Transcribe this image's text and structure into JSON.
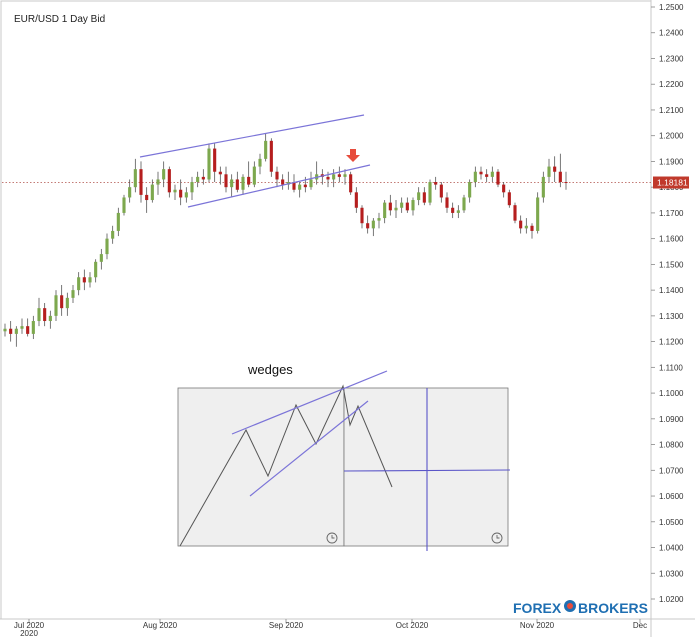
{
  "chart_data": {
    "type": "candlestick",
    "title": "EUR/USD  1 Day Bid",
    "ylim": [
      1.01,
      1.25
    ],
    "y_ticks": [
      "1.2500",
      "1.2400",
      "1.2300",
      "1.2200",
      "1.2100",
      "1.2000",
      "1.1900",
      "1.1800",
      "1.1700",
      "1.1600",
      "1.1500",
      "1.1400",
      "1.1300",
      "1.1200",
      "1.1100",
      "1.1000",
      "1.0900",
      "1.0800",
      "1.0700",
      "1.0600",
      "1.0500",
      "1.0400",
      "1.0300",
      "1.0200"
    ],
    "x_ticks": [
      "Jul 2020",
      "Aug 2020",
      "Sep 2020",
      "Oct 2020",
      "Nov 2020",
      "Dec"
    ],
    "x_ticks_year": [
      "2020"
    ],
    "current_price": "1.18181",
    "annotation": "wedges",
    "colors": {
      "up": "#7da84e",
      "down": "#b51e1e",
      "trendline": "#7b74d8",
      "price_tag": "#c0392b",
      "arrow": "#e74c3c",
      "axis_text": "#333333"
    },
    "candles": [
      [
        1.124,
        1.127,
        1.122,
        1.125
      ],
      [
        1.125,
        1.128,
        1.12,
        1.123
      ],
      [
        1.123,
        1.126,
        1.118,
        1.125
      ],
      [
        1.125,
        1.129,
        1.123,
        1.126
      ],
      [
        1.126,
        1.129,
        1.122,
        1.123
      ],
      [
        1.123,
        1.13,
        1.121,
        1.128
      ],
      [
        1.128,
        1.137,
        1.126,
        1.133
      ],
      [
        1.133,
        1.135,
        1.126,
        1.128
      ],
      [
        1.128,
        1.132,
        1.125,
        1.13
      ],
      [
        1.13,
        1.14,
        1.128,
        1.138
      ],
      [
        1.138,
        1.142,
        1.13,
        1.133
      ],
      [
        1.133,
        1.139,
        1.13,
        1.137
      ],
      [
        1.137,
        1.142,
        1.135,
        1.14
      ],
      [
        1.14,
        1.147,
        1.138,
        1.145
      ],
      [
        1.145,
        1.148,
        1.14,
        1.143
      ],
      [
        1.143,
        1.147,
        1.141,
        1.145
      ],
      [
        1.145,
        1.152,
        1.143,
        1.151
      ],
      [
        1.151,
        1.156,
        1.148,
        1.154
      ],
      [
        1.154,
        1.162,
        1.152,
        1.16
      ],
      [
        1.16,
        1.165,
        1.158,
        1.163
      ],
      [
        1.163,
        1.172,
        1.161,
        1.17
      ],
      [
        1.17,
        1.177,
        1.169,
        1.176
      ],
      [
        1.176,
        1.183,
        1.174,
        1.18
      ],
      [
        1.18,
        1.191,
        1.178,
        1.187
      ],
      [
        1.187,
        1.19,
        1.174,
        1.177
      ],
      [
        1.177,
        1.18,
        1.17,
        1.175
      ],
      [
        1.175,
        1.183,
        1.174,
        1.181
      ],
      [
        1.181,
        1.186,
        1.177,
        1.183
      ],
      [
        1.183,
        1.19,
        1.18,
        1.187
      ],
      [
        1.187,
        1.188,
        1.176,
        1.178
      ],
      [
        1.178,
        1.181,
        1.175,
        1.179
      ],
      [
        1.179,
        1.183,
        1.173,
        1.176
      ],
      [
        1.176,
        1.18,
        1.174,
        1.178
      ],
      [
        1.178,
        1.184,
        1.175,
        1.182
      ],
      [
        1.182,
        1.186,
        1.18,
        1.184
      ],
      [
        1.184,
        1.187,
        1.181,
        1.183
      ],
      [
        1.183,
        1.197,
        1.182,
        1.195
      ],
      [
        1.195,
        1.197,
        1.182,
        1.186
      ],
      [
        1.186,
        1.188,
        1.181,
        1.185
      ],
      [
        1.185,
        1.188,
        1.178,
        1.18
      ],
      [
        1.18,
        1.185,
        1.176,
        1.183
      ],
      [
        1.183,
        1.186,
        1.178,
        1.179
      ],
      [
        1.179,
        1.185,
        1.177,
        1.184
      ],
      [
        1.184,
        1.19,
        1.18,
        1.181
      ],
      [
        1.181,
        1.19,
        1.18,
        1.188
      ],
      [
        1.188,
        1.193,
        1.185,
        1.191
      ],
      [
        1.191,
        1.201,
        1.19,
        1.198
      ],
      [
        1.198,
        1.199,
        1.184,
        1.186
      ],
      [
        1.186,
        1.188,
        1.18,
        1.183
      ],
      [
        1.183,
        1.185,
        1.179,
        1.181
      ],
      [
        1.181,
        1.186,
        1.179,
        1.182
      ],
      [
        1.182,
        1.185,
        1.178,
        1.179
      ],
      [
        1.179,
        1.182,
        1.176,
        1.181
      ],
      [
        1.181,
        1.184,
        1.178,
        1.18
      ],
      [
        1.18,
        1.186,
        1.179,
        1.183
      ],
      [
        1.183,
        1.19,
        1.181,
        1.185
      ],
      [
        1.185,
        1.187,
        1.181,
        1.184
      ],
      [
        1.184,
        1.186,
        1.18,
        1.183
      ],
      [
        1.183,
        1.187,
        1.18,
        1.185
      ],
      [
        1.185,
        1.188,
        1.182,
        1.184
      ],
      [
        1.184,
        1.187,
        1.181,
        1.185
      ],
      [
        1.185,
        1.186,
        1.177,
        1.178
      ],
      [
        1.178,
        1.18,
        1.17,
        1.172
      ],
      [
        1.172,
        1.173,
        1.164,
        1.166
      ],
      [
        1.166,
        1.169,
        1.162,
        1.164
      ],
      [
        1.164,
        1.168,
        1.161,
        1.167
      ],
      [
        1.167,
        1.17,
        1.164,
        1.168
      ],
      [
        1.168,
        1.175,
        1.166,
        1.174
      ],
      [
        1.174,
        1.177,
        1.169,
        1.171
      ],
      [
        1.171,
        1.175,
        1.168,
        1.172
      ],
      [
        1.172,
        1.176,
        1.17,
        1.174
      ],
      [
        1.174,
        1.176,
        1.17,
        1.171
      ],
      [
        1.171,
        1.176,
        1.169,
        1.175
      ],
      [
        1.175,
        1.18,
        1.173,
        1.178
      ],
      [
        1.178,
        1.18,
        1.173,
        1.174
      ],
      [
        1.174,
        1.183,
        1.173,
        1.182
      ],
      [
        1.182,
        1.184,
        1.179,
        1.181
      ],
      [
        1.181,
        1.182,
        1.174,
        1.176
      ],
      [
        1.176,
        1.178,
        1.17,
        1.172
      ],
      [
        1.172,
        1.174,
        1.168,
        1.17
      ],
      [
        1.17,
        1.173,
        1.168,
        1.171
      ],
      [
        1.171,
        1.177,
        1.17,
        1.176
      ],
      [
        1.176,
        1.183,
        1.174,
        1.182
      ],
      [
        1.182,
        1.188,
        1.18,
        1.186
      ],
      [
        1.186,
        1.188,
        1.183,
        1.185
      ],
      [
        1.185,
        1.187,
        1.182,
        1.184
      ],
      [
        1.184,
        1.188,
        1.182,
        1.186
      ],
      [
        1.186,
        1.187,
        1.18,
        1.181
      ],
      [
        1.181,
        1.182,
        1.176,
        1.178
      ],
      [
        1.178,
        1.179,
        1.172,
        1.173
      ],
      [
        1.173,
        1.174,
        1.166,
        1.167
      ],
      [
        1.167,
        1.169,
        1.162,
        1.164
      ],
      [
        1.164,
        1.168,
        1.162,
        1.165
      ],
      [
        1.165,
        1.166,
        1.16,
        1.163
      ],
      [
        1.163,
        1.178,
        1.162,
        1.176
      ],
      [
        1.176,
        1.186,
        1.174,
        1.184
      ],
      [
        1.184,
        1.191,
        1.182,
        1.188
      ],
      [
        1.188,
        1.192,
        1.182,
        1.186
      ],
      [
        1.186,
        1.193,
        1.18,
        1.182
      ],
      [
        1.182,
        1.186,
        1.179,
        1.1818
      ]
    ]
  },
  "inset": {
    "label": "wedges"
  },
  "brand": {
    "text_forex": "FOREX",
    "text_brokers": "BROKERS",
    "colors": {
      "forex": "#1f6fb2",
      "brokers": "#1f6fb2",
      "logo_accent": "#e74c3c"
    }
  }
}
